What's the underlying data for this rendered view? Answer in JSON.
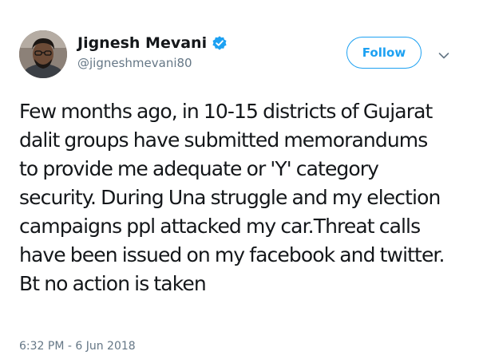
{
  "user": {
    "display_name": "Jignesh Mevani",
    "handle": "@jigneshmevani80",
    "verified": true,
    "avatar_icon": "profile-photo"
  },
  "actions": {
    "follow_label": "Follow",
    "more_icon": "chevron-down-icon"
  },
  "tweet": {
    "lines": [
      "Few months ago, in 10-15 districts of Gujarat",
      "dalit groups have submitted memorandums",
      "to provide me adequate or 'Y' category",
      "security. During Una struggle and my election",
      "campaigns ppl attacked my car.Threat calls",
      "have been issued on my facebook and twitter.",
      "Bt no action is taken"
    ],
    "timestamp": "6:32 PM - 6 Jun 2018"
  },
  "colors": {
    "accent": "#1da1f2",
    "text": "#14171a",
    "secondary_text": "#657786",
    "verified_badge": "#1da1f2"
  }
}
